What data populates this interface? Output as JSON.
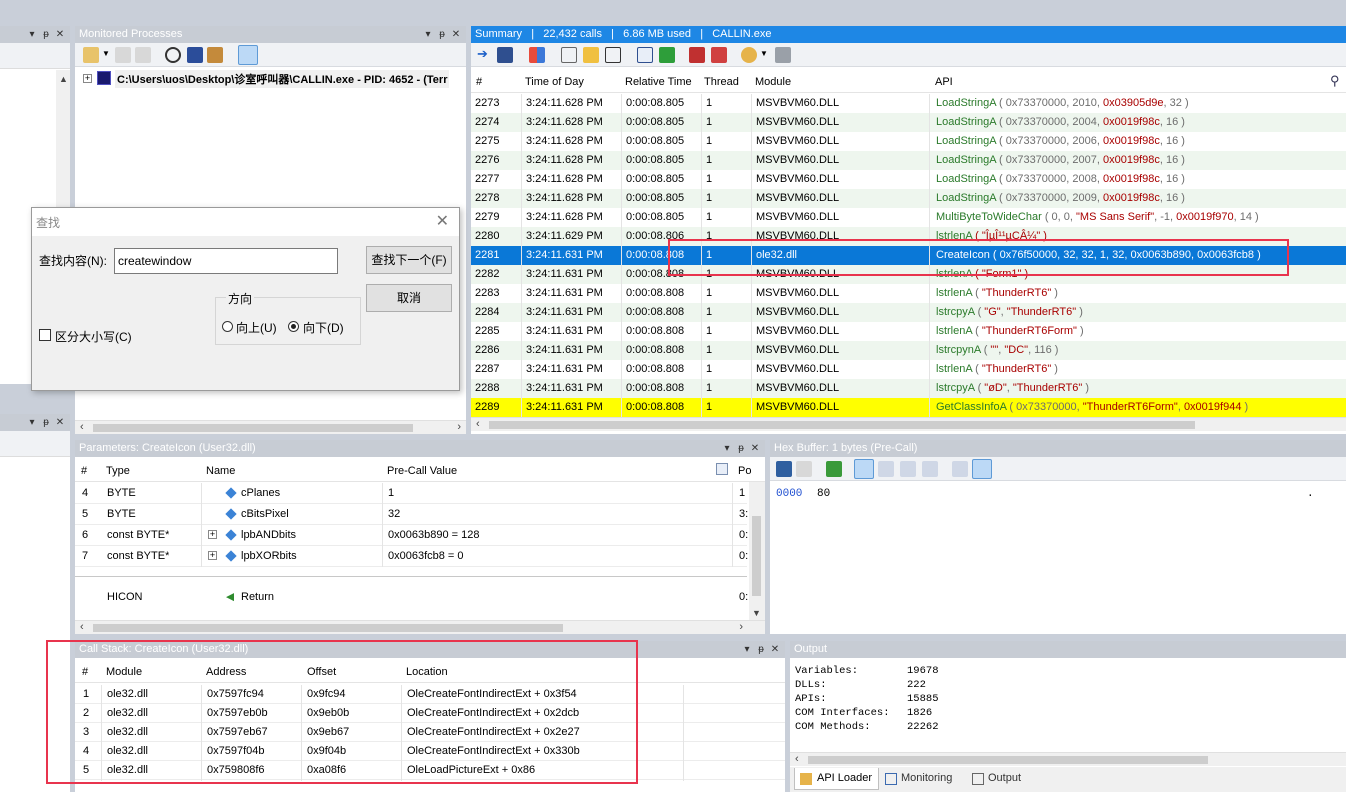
{
  "left_panel": {
    "btns": [
      "▾",
      "ᵽ",
      "✕"
    ]
  },
  "left_panel2": {
    "btns": [
      "▾",
      "ᵽ",
      "✕"
    ]
  },
  "processes": {
    "title": "Monitored Processes",
    "btns": [
      "▾",
      "ᵽ",
      "✕"
    ],
    "item": "C:\\Users\\uos\\Desktop\\诊室呼叫器\\CALLIN.exe - PID: 4652 - (Terr"
  },
  "find": {
    "title": "查找",
    "label": "查找内容(N):",
    "value": "createwindow",
    "find_next": "查找下一个(F)",
    "cancel": "取消",
    "direction": "方向",
    "up": "向上(U)",
    "down": "向下(D)",
    "match_case": "区分大小写(C)"
  },
  "summary": {
    "title": "Summary   |   22,432 calls   |   6.86 MB used   |   CALLIN.exe",
    "columns": [
      "#",
      "Time of Day",
      "Relative Time",
      "Thread",
      "Module",
      "API"
    ],
    "rows": [
      {
        "n": "2273",
        "t": "3:24:11.628 PM",
        "r": "0:00:08.805",
        "th": "1",
        "m": "MSVBVM60.DLL",
        "fn": "LoadStringA",
        "a": [
          [
            "g",
            " ( "
          ],
          [
            "g",
            "0x73370000"
          ],
          [
            "g",
            ", 2010, "
          ],
          [
            "r",
            "0x03905d9e"
          ],
          [
            "g",
            ", 32 )"
          ]
        ]
      },
      {
        "n": "2274",
        "t": "3:24:11.628 PM",
        "r": "0:00:08.805",
        "th": "1",
        "m": "MSVBVM60.DLL",
        "fn": "LoadStringA",
        "a": [
          [
            "g",
            " ( 0x73370000, 2004, "
          ],
          [
            "r",
            "0x0019f98c"
          ],
          [
            "g",
            ", 16 )"
          ]
        ]
      },
      {
        "n": "2275",
        "t": "3:24:11.628 PM",
        "r": "0:00:08.805",
        "th": "1",
        "m": "MSVBVM60.DLL",
        "fn": "LoadStringA",
        "a": [
          [
            "g",
            " ( 0x73370000, 2006, "
          ],
          [
            "r",
            "0x0019f98c"
          ],
          [
            "g",
            ", 16 )"
          ]
        ]
      },
      {
        "n": "2276",
        "t": "3:24:11.628 PM",
        "r": "0:00:08.805",
        "th": "1",
        "m": "MSVBVM60.DLL",
        "fn": "LoadStringA",
        "a": [
          [
            "g",
            " ( 0x73370000, 2007, "
          ],
          [
            "r",
            "0x0019f98c"
          ],
          [
            "g",
            ", 16 )"
          ]
        ]
      },
      {
        "n": "2277",
        "t": "3:24:11.628 PM",
        "r": "0:00:08.805",
        "th": "1",
        "m": "MSVBVM60.DLL",
        "fn": "LoadStringA",
        "a": [
          [
            "g",
            " ( 0x73370000, 2008, "
          ],
          [
            "r",
            "0x0019f98c"
          ],
          [
            "g",
            ", 16 )"
          ]
        ]
      },
      {
        "n": "2278",
        "t": "3:24:11.628 PM",
        "r": "0:00:08.805",
        "th": "1",
        "m": "MSVBVM60.DLL",
        "fn": "LoadStringA",
        "a": [
          [
            "g",
            " ( 0x73370000, 2009, "
          ],
          [
            "r",
            "0x0019f98c"
          ],
          [
            "g",
            ", 16 )"
          ]
        ]
      },
      {
        "n": "2279",
        "t": "3:24:11.628 PM",
        "r": "0:00:08.805",
        "th": "1",
        "m": "MSVBVM60.DLL",
        "fn": "MultiByteToWideChar",
        "a": [
          [
            "g",
            " ( 0, 0, "
          ],
          [
            "r",
            "\"MS Sans Serif\""
          ],
          [
            "g",
            ", -1, "
          ],
          [
            "r",
            "0x0019f970"
          ],
          [
            "g",
            ", 14 )"
          ]
        ]
      },
      {
        "n": "2280",
        "t": "3:24:11.629 PM",
        "r": "0:00:08.806",
        "th": "1",
        "m": "MSVBVM60.DLL",
        "fn": "lstrlenA",
        "a": [
          [
            "r",
            " ( \"ÎµÎ¹¹µCÂ¼\" )"
          ]
        ]
      },
      {
        "n": "2281",
        "t": "3:24:11.631 PM",
        "r": "0:00:08.808",
        "th": "1",
        "m": "ole32.dll",
        "fn": "CreateIcon",
        "sel": true,
        "a": [
          [
            "w",
            " ( 0x76f50000, 32, 32, 1, 32, 0x0063b890, 0x0063fcb8 )"
          ]
        ]
      },
      {
        "n": "2282",
        "t": "3:24:11.631 PM",
        "r": "0:00:08.808",
        "th": "1",
        "m": "MSVBVM60.DLL",
        "fn": "lstrlenA",
        "a": [
          [
            "r",
            " ( \"Form1\" )"
          ]
        ]
      },
      {
        "n": "2283",
        "t": "3:24:11.631 PM",
        "r": "0:00:08.808",
        "th": "1",
        "m": "MSVBVM60.DLL",
        "fn": "lstrlenA",
        "a": [
          [
            "g",
            " ( "
          ],
          [
            "r",
            "\"ThunderRT6\""
          ],
          [
            "g",
            " )"
          ]
        ]
      },
      {
        "n": "2284",
        "t": "3:24:11.631 PM",
        "r": "0:00:08.808",
        "th": "1",
        "m": "MSVBVM60.DLL",
        "fn": "lstrcpyA",
        "a": [
          [
            "g",
            " ( "
          ],
          [
            "r",
            "\"G\""
          ],
          [
            "g",
            ", "
          ],
          [
            "r",
            "\"ThunderRT6\""
          ],
          [
            "g",
            " )"
          ]
        ]
      },
      {
        "n": "2285",
        "t": "3:24:11.631 PM",
        "r": "0:00:08.808",
        "th": "1",
        "m": "MSVBVM60.DLL",
        "fn": "lstrlenA",
        "a": [
          [
            "g",
            " ( "
          ],
          [
            "r",
            "\"ThunderRT6Form\""
          ],
          [
            "g",
            " )"
          ]
        ]
      },
      {
        "n": "2286",
        "t": "3:24:11.631 PM",
        "r": "0:00:08.808",
        "th": "1",
        "m": "MSVBVM60.DLL",
        "fn": "lstrcpynA",
        "a": [
          [
            "g",
            " ( "
          ],
          [
            "r",
            "\"\""
          ],
          [
            "g",
            ", "
          ],
          [
            "r",
            "\"DC\""
          ],
          [
            "g",
            ", 116 )"
          ]
        ]
      },
      {
        "n": "2287",
        "t": "3:24:11.631 PM",
        "r": "0:00:08.808",
        "th": "1",
        "m": "MSVBVM60.DLL",
        "fn": "lstrlenA",
        "a": [
          [
            "g",
            " ( "
          ],
          [
            "r",
            "\"ThunderRT6\""
          ],
          [
            "g",
            " )"
          ]
        ]
      },
      {
        "n": "2288",
        "t": "3:24:11.631 PM",
        "r": "0:00:08.808",
        "th": "1",
        "m": "MSVBVM60.DLL",
        "fn": "lstrcpyA",
        "a": [
          [
            "g",
            " ( "
          ],
          [
            "r",
            "\"øD\""
          ],
          [
            "g",
            ", "
          ],
          [
            "r",
            "\"ThunderRT6\""
          ],
          [
            "g",
            " )"
          ]
        ]
      },
      {
        "n": "2289",
        "t": "3:24:11.631 PM",
        "r": "0:00:08.808",
        "th": "1",
        "m": "MSVBVM60.DLL",
        "fn": "GetClassInfoA",
        "hl": true,
        "a": [
          [
            "g",
            " ( 0x73370000, "
          ],
          [
            "r",
            "\"ThunderRT6Form\""
          ],
          [
            "g",
            ", "
          ],
          [
            "r",
            "0x0019f944"
          ],
          [
            "g",
            " )"
          ]
        ]
      }
    ]
  },
  "params": {
    "title": "Parameters: CreateIcon (User32.dll)",
    "btns": [
      "▾",
      "ᵽ",
      "✕"
    ],
    "columns": [
      "#",
      "Type",
      "Name",
      "Pre-Call Value",
      "Po"
    ],
    "rows": [
      {
        "n": "4",
        "type": "BYTE",
        "name": "cPlanes",
        "val": "1",
        "post": "1",
        "expand": false
      },
      {
        "n": "5",
        "type": "BYTE",
        "name": "cBitsPixel",
        "val": "32",
        "post": "3:",
        "expand": false
      },
      {
        "n": "6",
        "type": "const BYTE*",
        "name": "lpbANDbits",
        "val": "0x0063b890 = 128",
        "post": "0:",
        "expand": true
      },
      {
        "n": "7",
        "type": "const BYTE*",
        "name": "lpbXORbits",
        "val": "0x0063fcb8 = 0",
        "post": "0:",
        "expand": true
      }
    ],
    "ret": {
      "type": "HICON",
      "name": "Return",
      "post": "0:"
    }
  },
  "hex": {
    "title": "Hex Buffer: 1 bytes (Pre-Call)",
    "btns": [
      "▾",
      "ᵽ",
      "✕"
    ],
    "offset": "0000",
    "bytes": "80",
    "ascii": "."
  },
  "callstack": {
    "title": "Call Stack: CreateIcon (User32.dll)",
    "btns": [
      "▾",
      "ᵽ",
      "✕"
    ],
    "columns": [
      "#",
      "Module",
      "Address",
      "Offset",
      "Location"
    ],
    "rows": [
      {
        "n": "1",
        "m": "ole32.dll",
        "a": "0x7597fc94",
        "o": "0x9fc94",
        "l": "OleCreateFontIndirectExt + 0x3f54"
      },
      {
        "n": "2",
        "m": "ole32.dll",
        "a": "0x7597eb0b",
        "o": "0x9eb0b",
        "l": "OleCreateFontIndirectExt + 0x2dcb"
      },
      {
        "n": "3",
        "m": "ole32.dll",
        "a": "0x7597eb67",
        "o": "0x9eb67",
        "l": "OleCreateFontIndirectExt + 0x2e27"
      },
      {
        "n": "4",
        "m": "ole32.dll",
        "a": "0x7597f04b",
        "o": "0x9f04b",
        "l": "OleCreateFontIndirectExt + 0x330b"
      },
      {
        "n": "5",
        "m": "ole32.dll",
        "a": "0x759808f6",
        "o": "0xa08f6",
        "l": "OleLoadPictureExt + 0x86"
      }
    ]
  },
  "output": {
    "title": "Output",
    "lines": [
      {
        "k": "Variables:",
        "v": "19678"
      },
      {
        "k": "DLLs:",
        "v": "222"
      },
      {
        "k": "APIs:",
        "v": "15885"
      },
      {
        "k": "COM Interfaces:",
        "v": "1826"
      },
      {
        "k": "COM Methods:",
        "v": "22262"
      }
    ],
    "tabs": [
      "API Loader",
      "Monitoring",
      "Output"
    ]
  },
  "colors": {
    "accent": "#1e87e5",
    "selected": "#0a78d7",
    "highlight": "#ffff00",
    "annotation": "#e8344d"
  }
}
